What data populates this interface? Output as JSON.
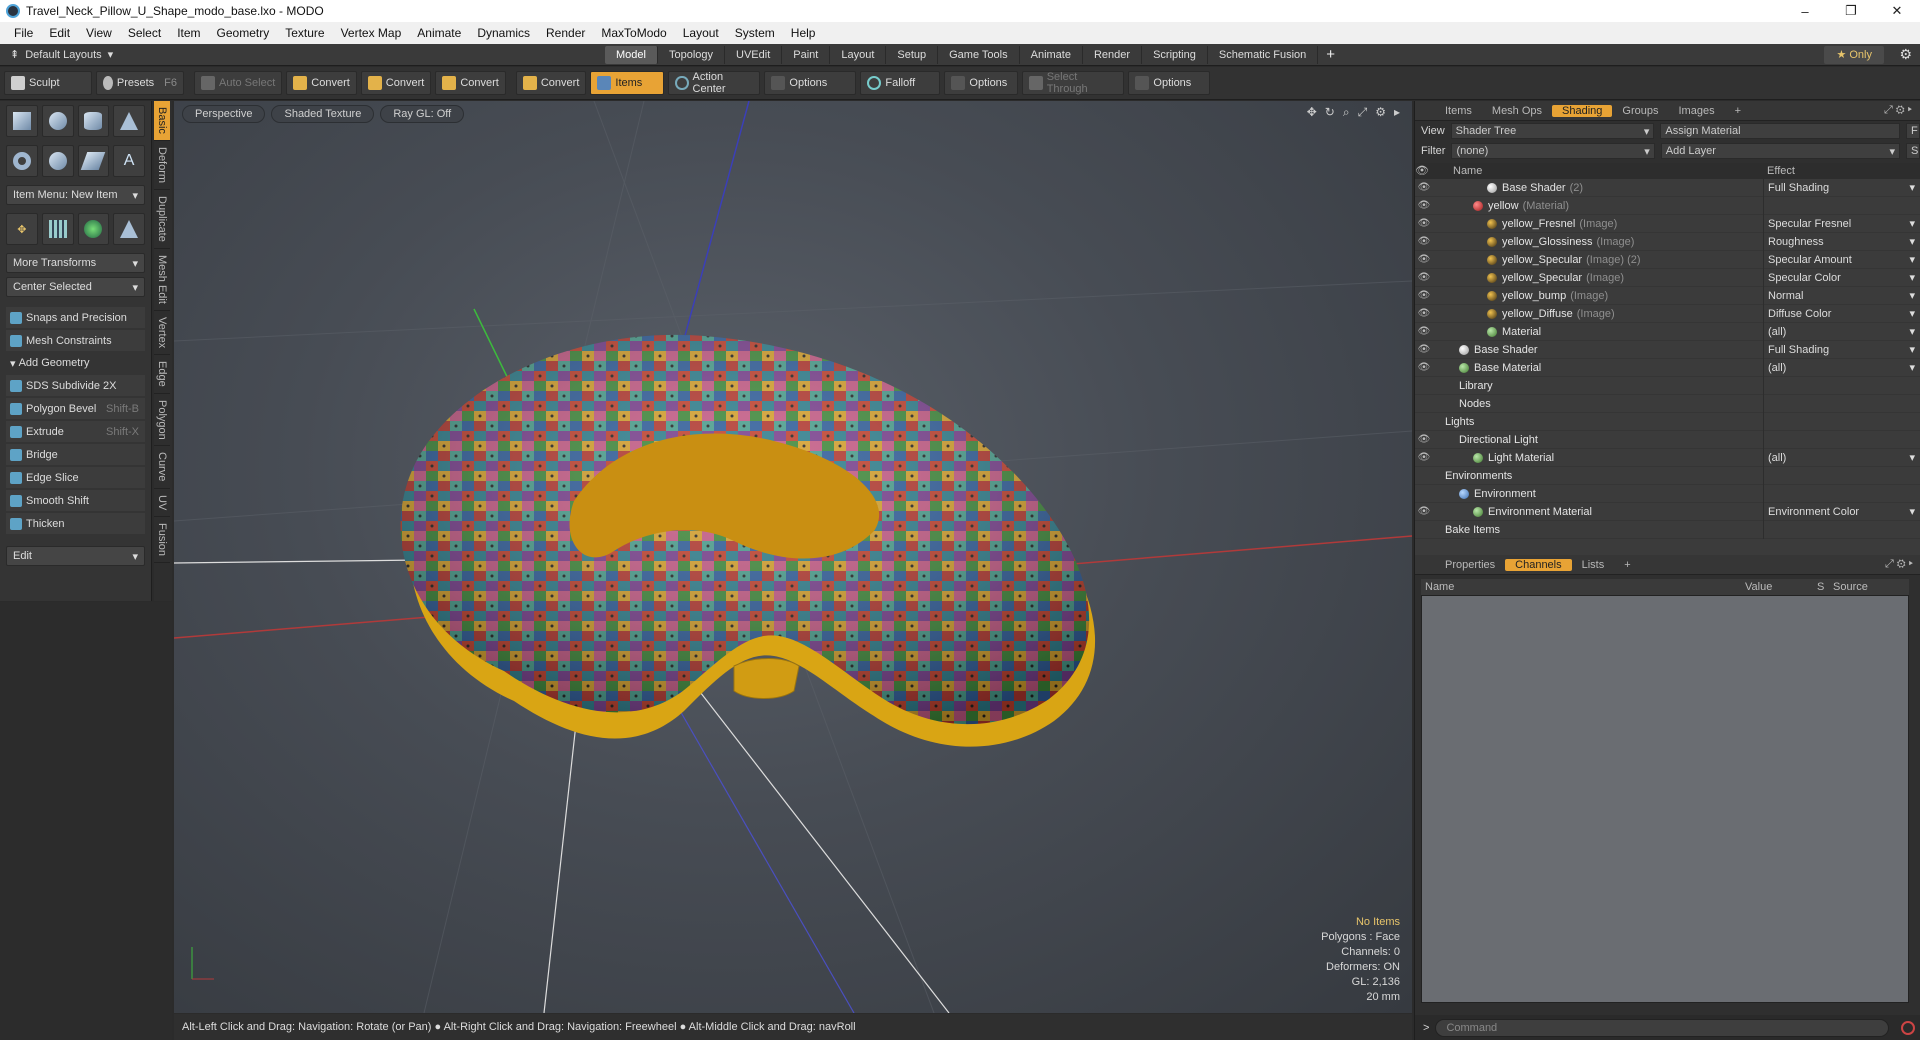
{
  "window": {
    "title": "Travel_Neck_Pillow_U_Shape_modo_base.lxo - MODO",
    "minimize": "–",
    "maximize": "❐",
    "close": "✕"
  },
  "menu": [
    "File",
    "Edit",
    "View",
    "Select",
    "Item",
    "Geometry",
    "Texture",
    "Vertex Map",
    "Animate",
    "Dynamics",
    "Render",
    "MaxToModo",
    "Layout",
    "System",
    "Help"
  ],
  "layoutbar": {
    "layouts_label": "Default Layouts",
    "tabs": [
      "Model",
      "Topology",
      "UVEdit",
      "Paint",
      "Layout",
      "Setup",
      "Game Tools",
      "Animate",
      "Render",
      "Scripting",
      "Schematic Fusion"
    ],
    "active_tab": "Model",
    "plus": "+",
    "only_label": "Only"
  },
  "toolbar": {
    "sculpt": "Sculpt",
    "presets": "Presets",
    "presets_key": "F6",
    "auto_select": "Auto Select",
    "convert1": "Convert",
    "convert2": "Convert",
    "convert3": "Convert",
    "convert4": "Convert",
    "items": "Items",
    "action_center": "Action Center",
    "options1": "Options",
    "falloff": "Falloff",
    "options2": "Options",
    "select_through": "Select Through",
    "options3": "Options"
  },
  "toolbox": {
    "item_menu": "Item Menu: New Item",
    "more_transforms": "More Transforms",
    "center_selected": "Center Selected",
    "snaps": "Snaps and Precision",
    "mesh_constraints": "Mesh Constraints",
    "add_geometry": "Add Geometry",
    "tools": [
      {
        "label": "SDS Subdivide 2X",
        "key": ""
      },
      {
        "label": "Polygon Bevel",
        "key": "Shift-B"
      },
      {
        "label": "Extrude",
        "key": "Shift-X"
      },
      {
        "label": "Bridge",
        "key": ""
      },
      {
        "label": "Edge Slice",
        "key": ""
      },
      {
        "label": "Smooth Shift",
        "key": ""
      },
      {
        "label": "Thicken",
        "key": ""
      }
    ],
    "edit": "Edit",
    "side_tabs": [
      "Basic",
      "Deform",
      "Duplicate",
      "Mesh Edit",
      "Vertex",
      "Edge",
      "Polygon",
      "Curve",
      "UV",
      "Fusion"
    ]
  },
  "viewport": {
    "view": "Perspective",
    "shading": "Shaded Texture",
    "raygl": "Ray GL: Off",
    "info": {
      "no_items": "No Items",
      "polygons": "Polygons : Face",
      "channels": "Channels: 0",
      "deformers": "Deformers: ON",
      "gl": "GL: 2,136",
      "scale": "20 mm"
    }
  },
  "status": "Alt-Left Click and Drag: Navigation: Rotate (or Pan) ● Alt-Right Click and Drag: Navigation: Freewheel ● Alt-Middle Click and Drag: navRoll",
  "shading_panel": {
    "tabs": [
      "Items",
      "Mesh Ops",
      "Shading",
      "Groups",
      "Images"
    ],
    "active": "Shading",
    "view_label": "View",
    "view_value": "Shader Tree",
    "assign": "Assign Material",
    "filter_label": "Filter",
    "filter_value": "(none)",
    "add_layer": "Add Layer",
    "col_name": "Name",
    "col_effect": "Effect",
    "rows": [
      {
        "indent": 3,
        "ball": "white",
        "name": "Base Shader",
        "type": "(2)",
        "effect": "Full Shading",
        "eye": true
      },
      {
        "indent": 2,
        "ball": "red",
        "name": "yellow",
        "type": "(Material)",
        "effect": "",
        "eye": true
      },
      {
        "indent": 3,
        "ball": "tex",
        "name": "yellow_Fresnel",
        "type": "(Image)",
        "effect": "Specular Fresnel",
        "eye": true
      },
      {
        "indent": 3,
        "ball": "tex",
        "name": "yellow_Glossiness",
        "type": "(Image)",
        "effect": "Roughness",
        "eye": true
      },
      {
        "indent": 3,
        "ball": "tex",
        "name": "yellow_Specular",
        "type": "(Image) (2)",
        "effect": "Specular Amount",
        "eye": true
      },
      {
        "indent": 3,
        "ball": "tex",
        "name": "yellow_Specular",
        "type": "(Image)",
        "effect": "Specular Color",
        "eye": true
      },
      {
        "indent": 3,
        "ball": "tex",
        "name": "yellow_bump",
        "type": "(Image)",
        "effect": "Normal",
        "eye": true
      },
      {
        "indent": 3,
        "ball": "tex",
        "name": "yellow_Diffuse",
        "type": "(Image)",
        "effect": "Diffuse Color",
        "eye": true
      },
      {
        "indent": 3,
        "ball": "green",
        "name": "Material",
        "type": "",
        "effect": "(all)",
        "eye": true
      },
      {
        "indent": 1,
        "ball": "white",
        "name": "Base Shader",
        "type": "",
        "effect": "Full Shading",
        "eye": true
      },
      {
        "indent": 1,
        "ball": "green",
        "name": "Base Material",
        "type": "",
        "effect": "(all)",
        "eye": true
      },
      {
        "indent": 1,
        "ball": "",
        "name": "Library",
        "type": "",
        "effect": "",
        "eye": false
      },
      {
        "indent": 1,
        "ball": "",
        "name": "Nodes",
        "type": "",
        "effect": "",
        "eye": false
      },
      {
        "indent": 0,
        "ball": "",
        "name": "Lights",
        "type": "",
        "effect": "",
        "eye": false
      },
      {
        "indent": 1,
        "ball": "",
        "name": "Directional Light",
        "type": "",
        "effect": "",
        "eye": true
      },
      {
        "indent": 2,
        "ball": "green",
        "name": "Light Material",
        "type": "",
        "effect": "(all)",
        "eye": true
      },
      {
        "indent": 0,
        "ball": "",
        "name": "Environments",
        "type": "",
        "effect": "",
        "eye": false
      },
      {
        "indent": 1,
        "ball": "blue",
        "name": "Environment",
        "type": "",
        "effect": "",
        "eye": false
      },
      {
        "indent": 2,
        "ball": "green",
        "name": "Environment Material",
        "type": "",
        "effect": "Environment Color",
        "eye": true
      },
      {
        "indent": 0,
        "ball": "",
        "name": "Bake Items",
        "type": "",
        "effect": "",
        "eye": false
      }
    ]
  },
  "props_panel": {
    "tabs": [
      "Properties",
      "Channels",
      "Lists"
    ],
    "active": "Channels",
    "cols": [
      "Name",
      "Value",
      "S",
      "Source"
    ]
  },
  "command": {
    "placeholder": "Command"
  },
  "colors": {
    "accent": "#e8a335",
    "pillow_base": "#d9a514"
  }
}
